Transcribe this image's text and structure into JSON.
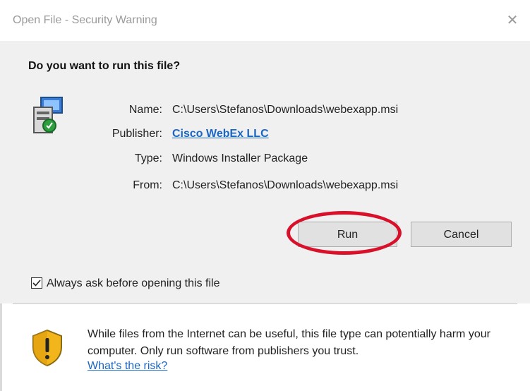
{
  "window": {
    "title": "Open File - Security Warning",
    "close_glyph": "✕"
  },
  "question": "Do you want to run this file?",
  "details": {
    "name_label": "Name:",
    "name_value": "C:\\Users\\Stefanos\\Downloads\\webexapp.msi",
    "publisher_label": "Publisher:",
    "publisher_value": "Cisco WebEx LLC",
    "type_label": "Type:",
    "type_value": "Windows Installer Package",
    "from_label": "From:",
    "from_value": "C:\\Users\\Stefanos\\Downloads\\webexapp.msi"
  },
  "buttons": {
    "run": "Run",
    "cancel": "Cancel"
  },
  "checkbox": {
    "label": "Always ask before opening this file",
    "checked": true
  },
  "warning": {
    "text": "While files from the Internet can be useful, this file type can potentially harm your computer. Only run software from publishers you trust.",
    "link": "What's the risk?"
  },
  "icons": {
    "file": "installer-package-icon",
    "shield": "security-shield-icon",
    "close": "close-icon",
    "check": "checkmark-icon"
  },
  "colors": {
    "link": "#1a66c2",
    "highlight": "#d8102a",
    "shield": "#f2b61c"
  }
}
